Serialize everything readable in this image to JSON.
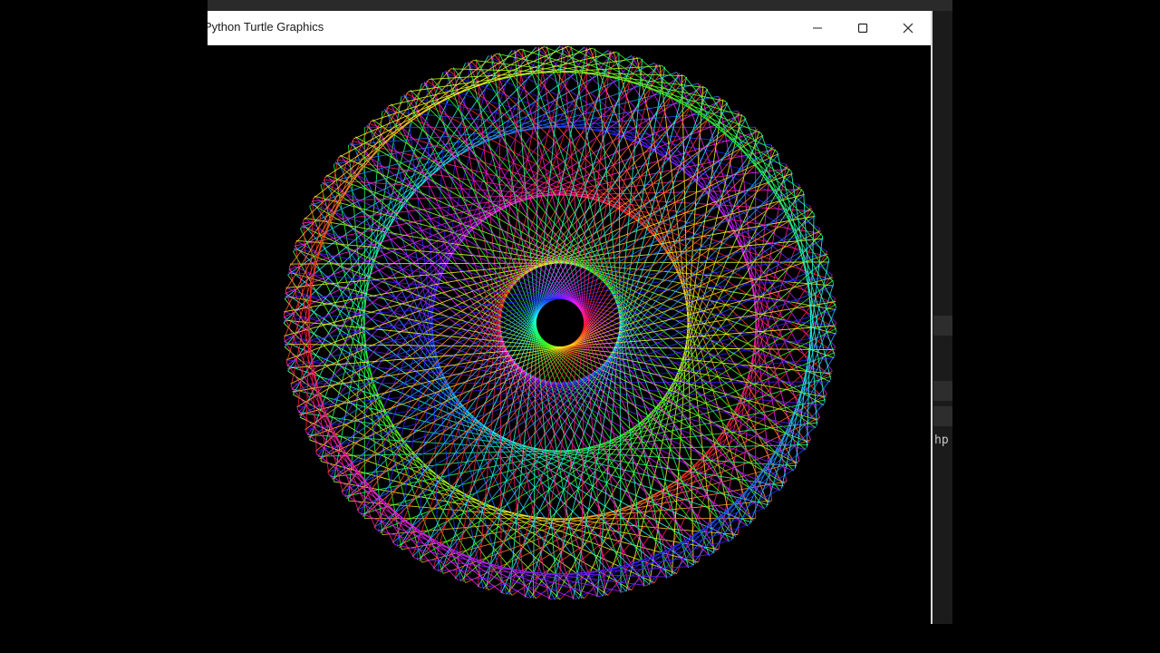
{
  "window": {
    "title": "Python Turtle Graphics",
    "controls": [
      "minimize-icon",
      "maximize-icon",
      "close-icon"
    ]
  },
  "background_app": {
    "partial_text": "hp"
  },
  "drawing": {
    "type": "spirograph string-art",
    "line_color": "rainbow (hue cycling)",
    "background_color": "#000000"
  }
}
